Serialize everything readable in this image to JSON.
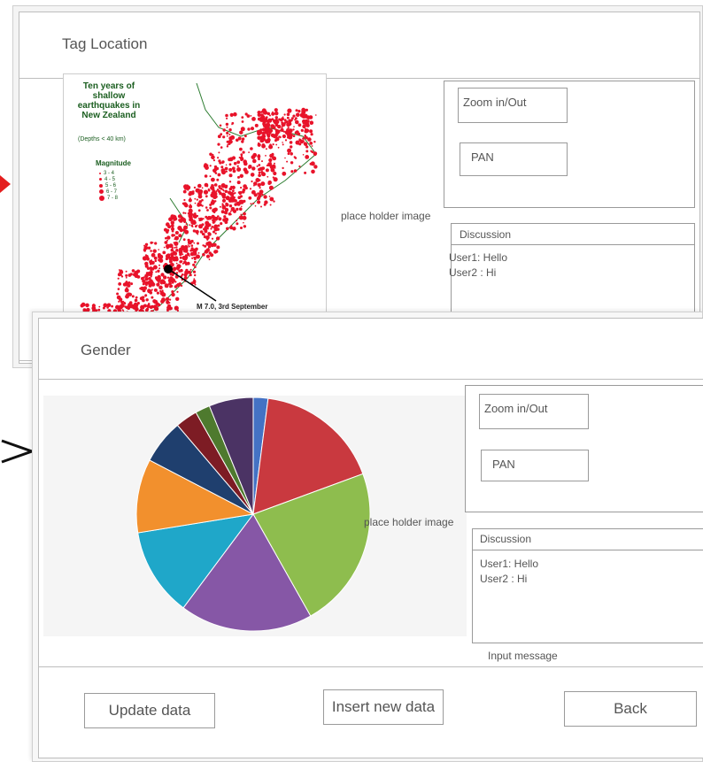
{
  "back_window": {
    "title": "Tag Location",
    "controls": {
      "zoom": "Zoom in/Out",
      "pan": "PAN"
    },
    "placeholder": "place holder image",
    "discussion": {
      "header": "Discussion",
      "messages": [
        "User1: Hello",
        "User2 : Hi"
      ]
    },
    "map": {
      "title": "Ten years of shallow earthquakes in New Zealand",
      "depth_note": "(Depths < 40 km)",
      "legend_title": "Magnitude",
      "legend_items": [
        "3 - 4",
        "4 - 5",
        "5 - 6",
        "6 - 7",
        "7 - 8"
      ],
      "annotation": "M 7.0, 3rd September",
      "dot_color": "#e8132a"
    }
  },
  "front_window": {
    "title": "Gender",
    "controls": {
      "zoom": "Zoom in/Out",
      "pan": "PAN"
    },
    "placeholder": "place holder image",
    "discussion": {
      "header": "Discussion",
      "messages": [
        "User1: Hello",
        "User2 : Hi"
      ],
      "input_placeholder": "Input message"
    },
    "buttons": {
      "update": "Update data",
      "insert": "Insert new data",
      "back": "Back"
    }
  },
  "chart_data": {
    "type": "pie",
    "values": [
      2,
      17,
      22,
      18,
      12,
      10,
      6,
      3,
      2,
      6
    ],
    "colors": [
      "#4472c4",
      "#c9393f",
      "#8ebd4e",
      "#8657a6",
      "#1fa7c9",
      "#f2902d",
      "#1f3f6e",
      "#7d1c24",
      "#4e7a2e",
      "#4b3364"
    ]
  },
  "arrow_color": "#e41e1e"
}
